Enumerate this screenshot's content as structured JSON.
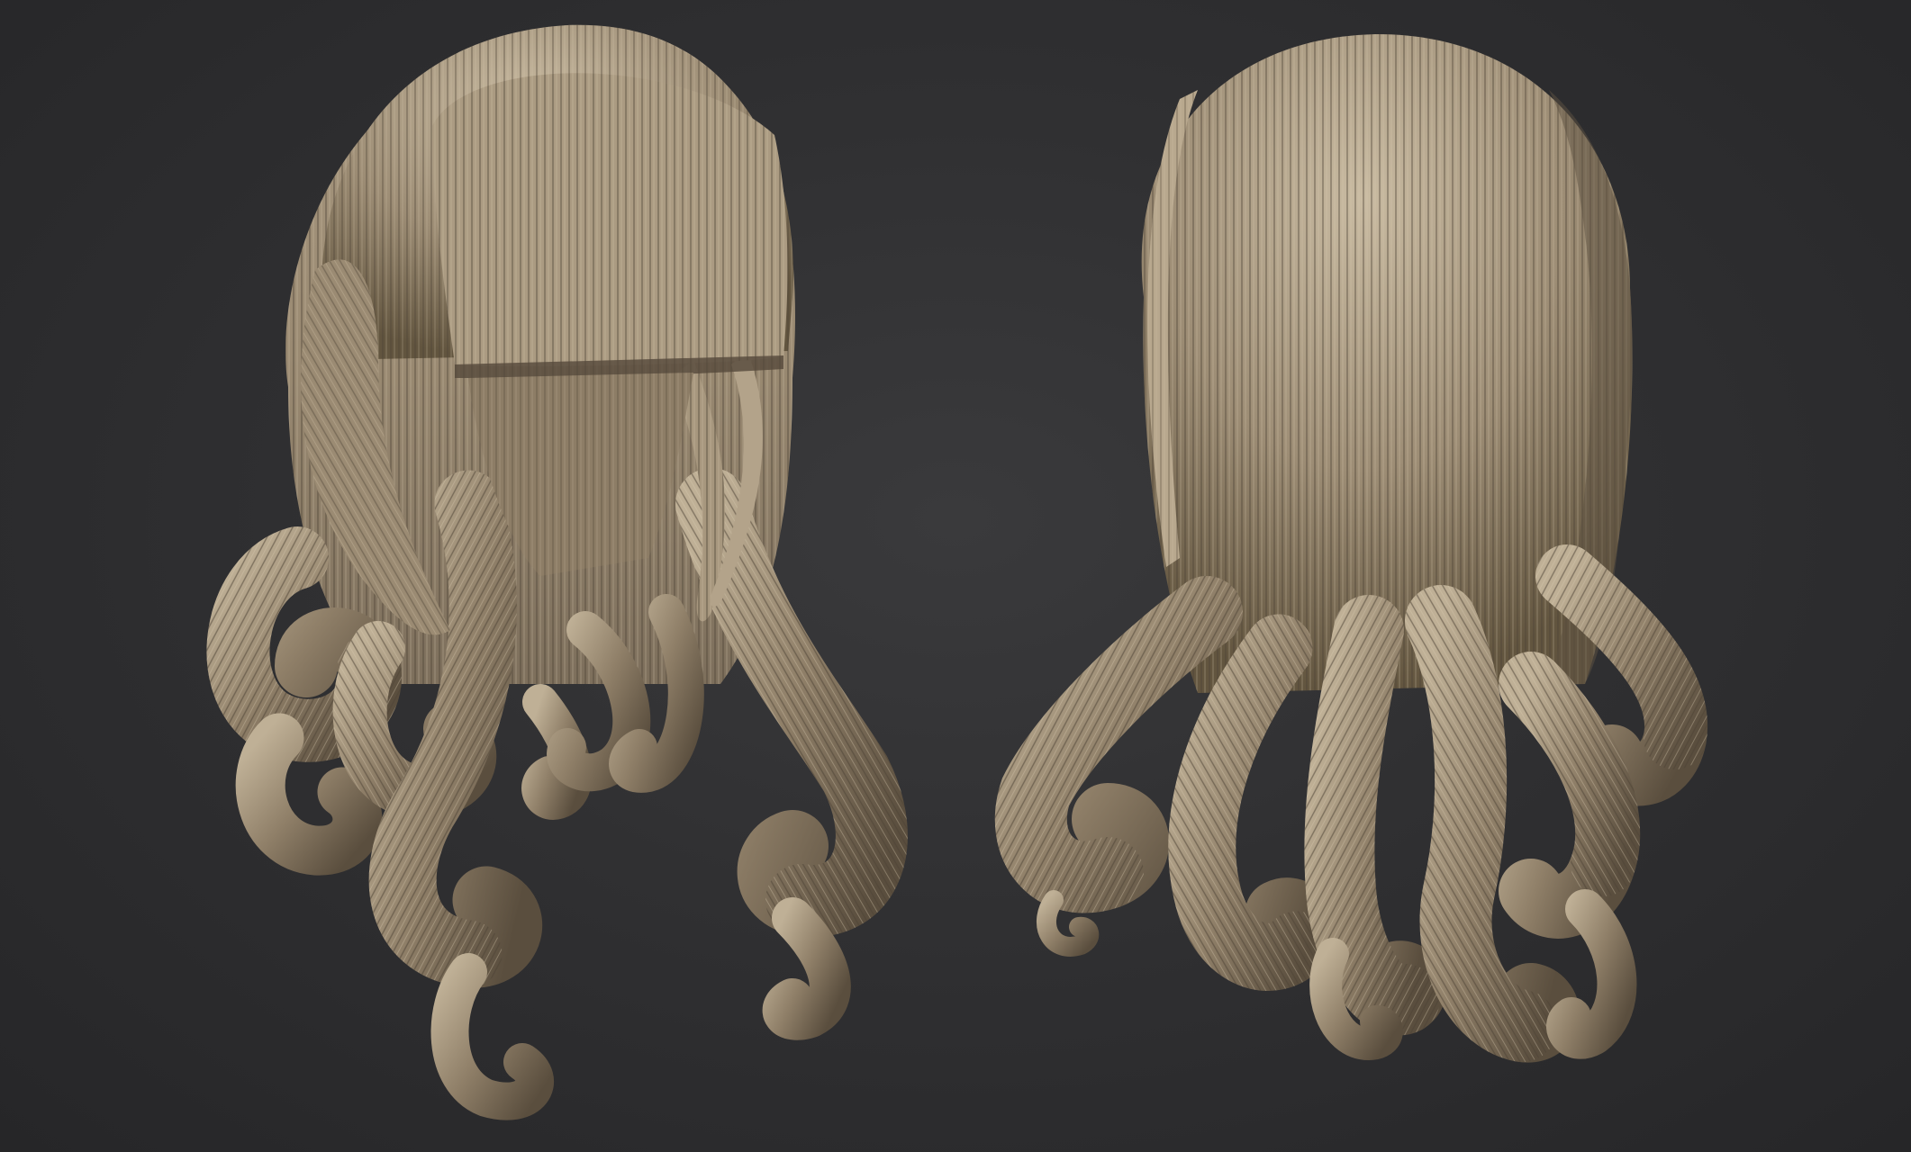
{
  "scene": {
    "background_color": "#303032",
    "material_color": "#9c8c74",
    "material_shadow": "#4a3f33",
    "material_highlight": "#d6c8b0",
    "models": [
      {
        "view": "front",
        "style": "long hair with blunt bangs and curled ends"
      },
      {
        "view": "back",
        "style": "long hair with curled ends"
      }
    ]
  }
}
